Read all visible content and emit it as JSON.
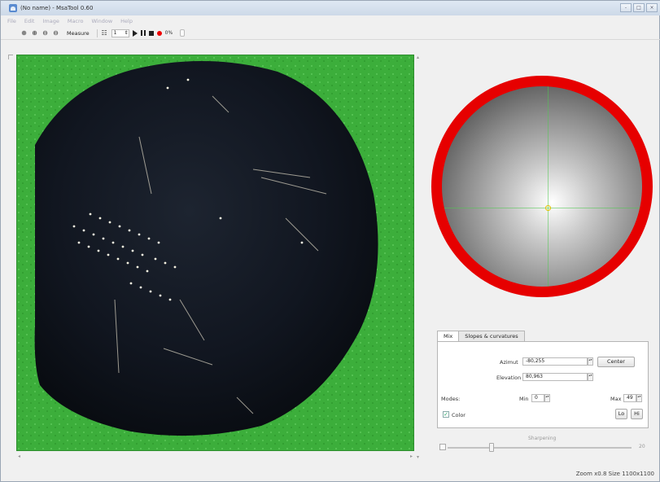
{
  "window": {
    "title": "(No name) - MsaTool 0.60",
    "controls": [
      "-",
      "□",
      "×"
    ]
  },
  "menu": [
    "File",
    "Edit",
    "Image",
    "Macro",
    "Window",
    "Help"
  ],
  "toolbar": {
    "zoom_icons": [
      "zoom-in-icon",
      "zoom-fit-icon",
      "zoom-out-icon",
      "zoom-reset-icon"
    ],
    "measure_label": "Measure",
    "frame_value": "1",
    "progress_text": "0%"
  },
  "panel": {
    "tabs": [
      "Mix",
      "Slopes & curvatures"
    ],
    "azimut_label": "Azimut",
    "azimut_value": "-80,255",
    "elevation_label": "Elevation",
    "elevation_value": "80,963",
    "center_label": "Center",
    "modes_label": "Modes:",
    "min_label": "Min",
    "min_value": "0",
    "max_label": "Max",
    "max_value": "49",
    "color_label": "Color",
    "color_checked": true,
    "lo_label": "Lo",
    "hi_label": "Hi"
  },
  "sharpening": {
    "label": "Sharpening",
    "max_label": "20",
    "value_fraction": 0.24
  },
  "status": {
    "text": "Zoom x0.8 Size 1100x1100"
  },
  "colors": {
    "background_green": "#3cae3b",
    "disc_ring": "#e60000",
    "surface_dark": "#141820"
  }
}
